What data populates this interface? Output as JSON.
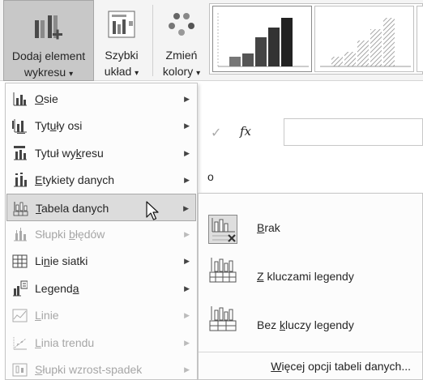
{
  "ribbon": {
    "add_element": {
      "line1": "Dodaj element",
      "line2": "wykresu",
      "icon": "add-chart-element-icon"
    },
    "quick_layout": {
      "line1": "Szybki",
      "line2": "układ",
      "icon": "quick-layout-icon"
    },
    "change_colors": {
      "line1": "Zmień",
      "line2": "kolory",
      "icon": "change-colors-icon"
    },
    "dropdown_glyph": "▾",
    "chart_styles": [
      "style-1",
      "style-2",
      "style-3"
    ]
  },
  "formula_bar": {
    "fx": "fx",
    "check": "✓"
  },
  "cell_text": "o",
  "menu": {
    "items": [
      {
        "pre": "",
        "ul": "O",
        "post": "sie",
        "disabled": false,
        "icon": "axes-icon"
      },
      {
        "pre": "Tyt",
        "ul": "u",
        "post": "ły osi",
        "disabled": false,
        "icon": "axis-titles-icon"
      },
      {
        "pre": "Tytuł wy",
        "ul": "k",
        "post": "resu",
        "disabled": false,
        "icon": "chart-title-icon"
      },
      {
        "pre": "",
        "ul": "E",
        "post": "tykiety danych",
        "disabled": false,
        "icon": "data-labels-icon"
      },
      {
        "pre": "",
        "ul": "T",
        "post": "abela danych",
        "disabled": false,
        "highlighted": true,
        "icon": "data-table-icon"
      },
      {
        "pre": "Słupki ",
        "ul": "b",
        "post": "łędów",
        "disabled": true,
        "icon": "error-bars-icon"
      },
      {
        "pre": "Li",
        "ul": "n",
        "post": "ie siatki",
        "disabled": false,
        "icon": "gridlines-icon"
      },
      {
        "pre": "Legend",
        "ul": "a",
        "post": "",
        "disabled": false,
        "icon": "legend-icon"
      },
      {
        "pre": "",
        "ul": "L",
        "post": "inie",
        "disabled": true,
        "icon": "lines-icon"
      },
      {
        "pre": "",
        "ul": "L",
        "post": "inia trendu",
        "disabled": true,
        "icon": "trendline-icon"
      },
      {
        "pre": "",
        "ul": "S",
        "post": "łupki wzrost-spadek",
        "disabled": true,
        "icon": "up-down-bars-icon"
      }
    ],
    "arrow": "▶"
  },
  "submenu": {
    "items": [
      {
        "pre": "",
        "ul": "B",
        "post": "rak",
        "icon": "no-data-table-icon"
      },
      {
        "pre": "",
        "ul": "Z",
        "post": " kluczami legendy",
        "icon": "table-with-legend-keys-icon"
      },
      {
        "pre": "Bez ",
        "ul": "k",
        "post": "luczy legendy",
        "icon": "table-no-legend-keys-icon"
      }
    ],
    "more": {
      "pre": "",
      "ul": "W",
      "post": "ięcej opcji tabeli danych..."
    }
  }
}
